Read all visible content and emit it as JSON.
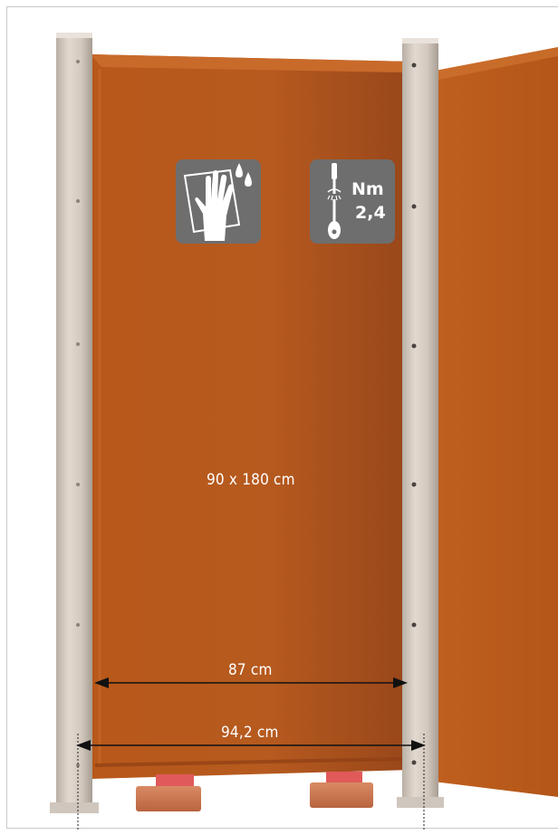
{
  "icons": {
    "cleaning": {
      "name": "cleaning-cloth-hand-icon"
    },
    "torque": {
      "name": "torque-wrench-icon",
      "unit": "Nm",
      "value": "2,4"
    }
  },
  "labels": {
    "panel_size": "90 x 180 cm",
    "inner_width": "87 cm",
    "outer_width": "94,2 cm"
  },
  "colors": {
    "panel": "#b4581c",
    "post": "#d6ccc2",
    "icon_background": "#6e6e6e",
    "brick": "#c97a55"
  }
}
